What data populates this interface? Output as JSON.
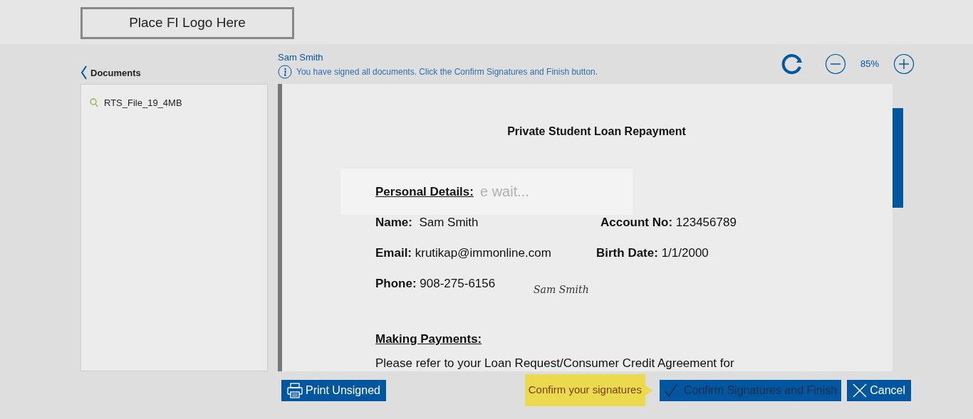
{
  "header": {
    "logo_text": "Place FI Logo Here"
  },
  "documents_panel": {
    "back_label": "Documents",
    "items": [
      {
        "name": "RTS_File_19_4MB"
      }
    ]
  },
  "signer_name": "Sam Smith",
  "info_message": "You have signed all documents. Click the Confirm Signatures and Finish button.",
  "zoom": {
    "value": "85%"
  },
  "document": {
    "title": "Private Student Loan Repayment",
    "personal_heading": "Personal Details:",
    "fields": [
      {
        "label": "Name:",
        "value": " Sam Smith"
      },
      {
        "label": "Account No:",
        "value": "123456789"
      },
      {
        "label": "Email:",
        "value": "krutikap@immonline.com"
      },
      {
        "label": "Birth Date:",
        "value": "1/1/2000"
      },
      {
        "label": "Phone:",
        "value": "908-275-6156"
      }
    ],
    "signature": "Sam Smith",
    "payments_heading": "Making Payments:",
    "payments_text": "Please refer to your Loan Request/Consumer Credit Agreement for"
  },
  "overlay": {
    "text": "e wait..."
  },
  "footer": {
    "print_button": "Print Unsigned",
    "hint": "Confirm your signatures",
    "confirm_button": "Confirm Signatures and Finish",
    "cancel_button": "Cancel"
  }
}
